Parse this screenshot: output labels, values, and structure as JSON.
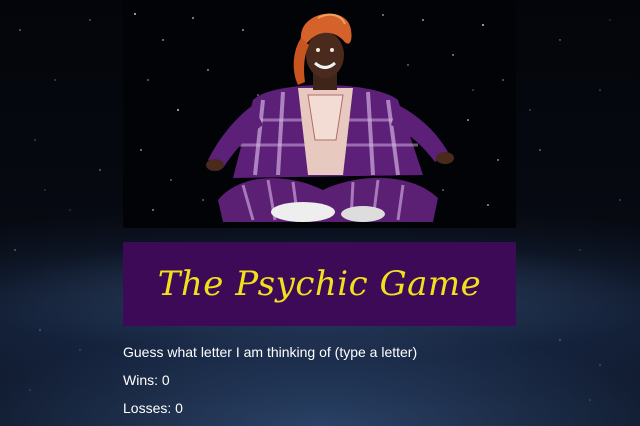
{
  "hero": {
    "image_subject": "psychic-figure-illustration"
  },
  "title": "The Psychic Game",
  "prompt": "Guess what letter I am thinking of (type a letter)",
  "stats": {
    "wins_text": "Wins: 0",
    "losses_text": "Losses: 0",
    "wins": 0,
    "losses": 0
  },
  "colors": {
    "banner_bg": "#3c0a57",
    "title_text": "#f2e01c",
    "body_text": "#ffffff",
    "page_bg": "#05070d"
  }
}
